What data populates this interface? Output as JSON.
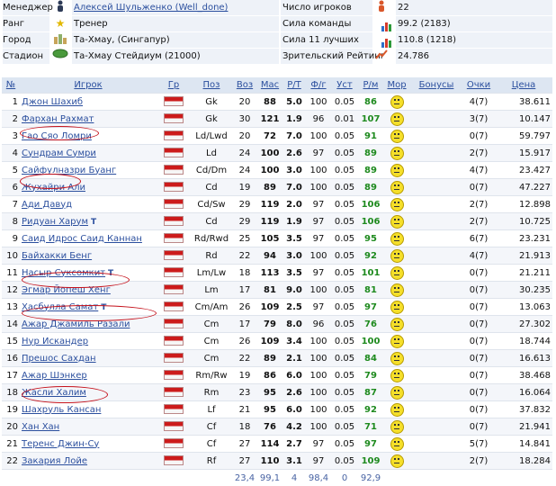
{
  "info": {
    "manager_label": "Менеджер",
    "manager_value": "Алексей Шульженко (Well_done)",
    "rank_label": "Ранг",
    "rank_value": "Тренер",
    "city_label": "Город",
    "city_value": "Та-Хмау, (Сингапур)",
    "stadium_label": "Стадион",
    "stadium_value": "Та-Хмау Стейдиум (21000)",
    "players_label": "Число игроков",
    "players_value": "22",
    "strength_label": "Сила команды",
    "strength_value": "99.2 (2183)",
    "best11_label": "Сила 11 лучших",
    "best11_value": "110.8 (1218)",
    "rating_label": "Зрительский Рейтинг",
    "rating_value": "24.786"
  },
  "headers": [
    "№",
    "Игрок",
    "Гр",
    "Поз",
    "Воз",
    "Мас",
    "Р/Т",
    "Ф/г",
    "Уст",
    "Р/м",
    "Мор",
    "Бонусы",
    "Очки",
    "Цена"
  ],
  "players": [
    [
      "1",
      "Джон Шахиб",
      "Gk",
      "20",
      "88",
      "5.0",
      "100",
      "0.05",
      "86",
      "",
      "4(7)",
      "38.611"
    ],
    [
      "2",
      "Фархан Рахмат",
      "Gk",
      "30",
      "121",
      "1.9",
      "96",
      "0.01",
      "107",
      "",
      "3(7)",
      "10.147"
    ],
    [
      "3",
      "Гао Сяо Ломри",
      "Ld/Lwd",
      "20",
      "72",
      "7.0",
      "100",
      "0.05",
      "91",
      "",
      "0(7)",
      "59.797"
    ],
    [
      "4",
      "Сундрам Сумри",
      "Ld",
      "24",
      "100",
      "2.6",
      "97",
      "0.05",
      "89",
      "",
      "2(7)",
      "15.917"
    ],
    [
      "5",
      "Сайфулназри Буанг",
      "Cd/Dm",
      "24",
      "100",
      "3.0",
      "100",
      "0.05",
      "89",
      "",
      "4(7)",
      "23.427"
    ],
    [
      "6",
      "Жухайри Али",
      "Cd",
      "19",
      "89",
      "7.0",
      "100",
      "0.05",
      "89",
      "",
      "0(7)",
      "47.227"
    ],
    [
      "7",
      "Ади Давуд",
      "Cd/Sw",
      "29",
      "119",
      "2.0",
      "97",
      "0.05",
      "106",
      "",
      "2(7)",
      "12.898"
    ],
    [
      "8",
      "Ридуан Харум",
      "Cd",
      "29",
      "119",
      "1.9",
      "97",
      "0.05",
      "106",
      "",
      "2(7)",
      "10.725"
    ],
    [
      "9",
      "Саид Идрос Саид Каннан",
      "Rd/Rwd",
      "25",
      "105",
      "3.5",
      "97",
      "0.05",
      "95",
      "",
      "6(7)",
      "23.231"
    ],
    [
      "10",
      "Байхакки Бенг",
      "Rd",
      "22",
      "94",
      "3.0",
      "100",
      "0.05",
      "92",
      "",
      "4(7)",
      "21.913"
    ],
    [
      "11",
      "Насыр Суксомкит",
      "Lm/Lw",
      "18",
      "113",
      "3.5",
      "97",
      "0.05",
      "101",
      "",
      "0(7)",
      "21.211"
    ],
    [
      "12",
      "Эгмар Йопеш Хенг",
      "Lm",
      "17",
      "81",
      "9.0",
      "100",
      "0.05",
      "81",
      "",
      "0(7)",
      "30.235"
    ],
    [
      "13",
      "Хасбулла Самат",
      "Cm/Am",
      "26",
      "109",
      "2.5",
      "97",
      "0.05",
      "97",
      "",
      "0(7)",
      "13.063"
    ],
    [
      "14",
      "Ажар Джамиль Разали",
      "Cm",
      "17",
      "79",
      "8.0",
      "96",
      "0.05",
      "76",
      "",
      "0(7)",
      "27.302"
    ],
    [
      "15",
      "Нур Искандер",
      "Cm",
      "26",
      "109",
      "3.4",
      "100",
      "0.05",
      "100",
      "",
      "0(7)",
      "18.744"
    ],
    [
      "16",
      "Прешос Сахдан",
      "Cm",
      "22",
      "89",
      "2.1",
      "100",
      "0.05",
      "84",
      "",
      "0(7)",
      "16.613"
    ],
    [
      "17",
      "Ажар Шэнкер",
      "Rm/Rw",
      "19",
      "86",
      "6.0",
      "100",
      "0.05",
      "79",
      "",
      "0(7)",
      "38.468"
    ],
    [
      "18",
      "Жасли Халим",
      "Rm",
      "23",
      "95",
      "2.6",
      "100",
      "0.05",
      "87",
      "",
      "0(7)",
      "16.064"
    ],
    [
      "19",
      "Шахруль Кансан",
      "Lf",
      "21",
      "95",
      "6.0",
      "100",
      "0.05",
      "92",
      "",
      "0(7)",
      "37.832"
    ],
    [
      "20",
      "Хан Хан",
      "Cf",
      "18",
      "76",
      "4.2",
      "100",
      "0.05",
      "71",
      "",
      "0(7)",
      "21.941"
    ],
    [
      "21",
      "Теренс Джин-Су",
      "Cf",
      "27",
      "114",
      "2.7",
      "97",
      "0.05",
      "97",
      "",
      "5(7)",
      "14.841"
    ],
    [
      "22",
      "Закария Лойе",
      "Rf",
      "27",
      "110",
      "3.1",
      "97",
      "0.05",
      "109",
      "",
      "2(7)",
      "18.284"
    ]
  ],
  "t_players": [
    "8",
    "11",
    "13"
  ],
  "footer": [
    "23,4",
    "99,1",
    "4",
    "98,4",
    "0",
    "92,9"
  ],
  "colors": {
    "header_bg": "#dde6f2",
    "link": "#2b4f9e",
    "rm_green": "#1e8a1e",
    "flag_red": "#cc1b1b",
    "annotation_red": "#c5121c"
  },
  "icons": {
    "manager": "person-icon",
    "rank": "star-icon",
    "city": "city-icon",
    "stadium": "stadium-icon",
    "players": "player-icon",
    "strength": "bar-chart-icon",
    "best11": "bar-chart-icon",
    "rating": "trend-icon"
  }
}
